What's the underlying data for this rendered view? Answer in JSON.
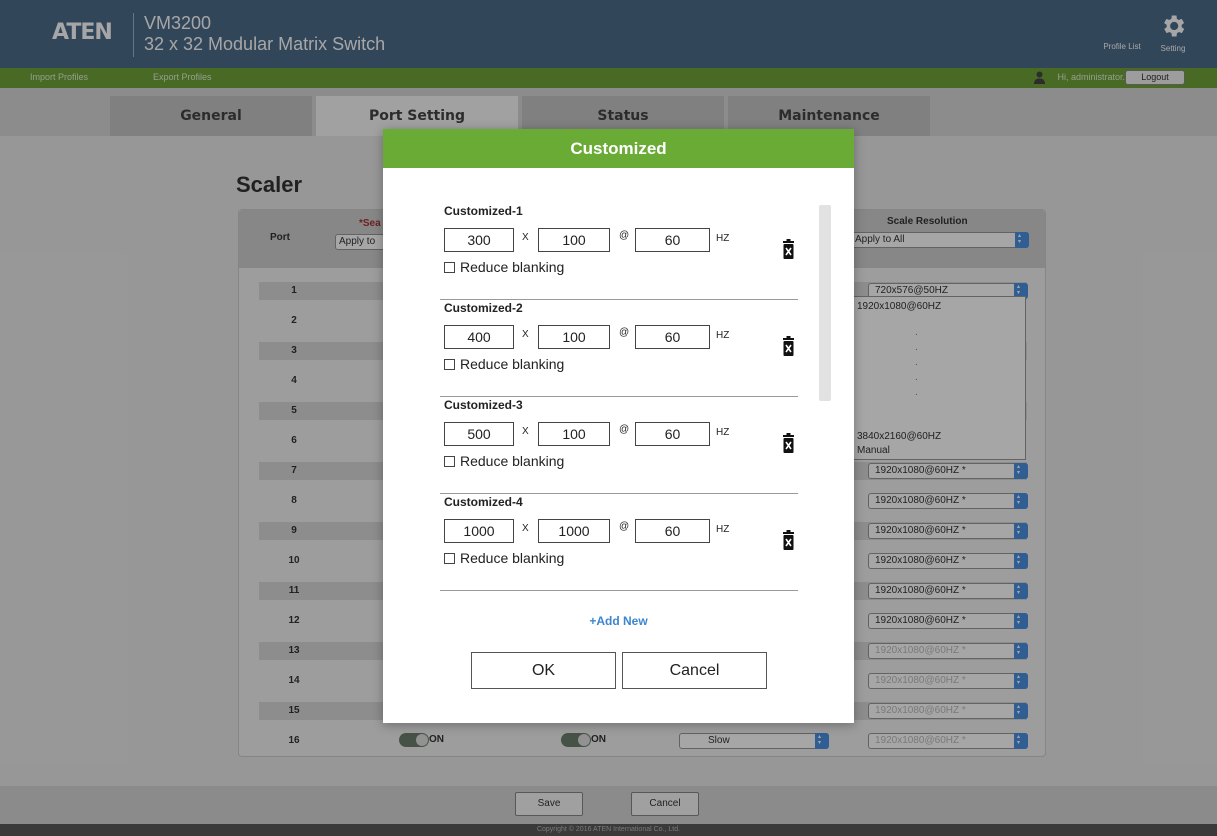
{
  "header": {
    "logo": "ATEN",
    "model": "VM3200",
    "product_name": "32 x 32 Modular Matrix Switch",
    "profile_list": "Profile List",
    "setting": "Setting"
  },
  "subbar": {
    "import_profiles": "Import Profiles",
    "export_profiles": "Export Profiles",
    "greeting": "Hi, administrator.",
    "logout": "Logout"
  },
  "tabs": [
    {
      "label": "General"
    },
    {
      "label": "Port Setting"
    },
    {
      "label": "Status"
    },
    {
      "label": "Maintenance"
    }
  ],
  "main": {
    "title": "Scaler",
    "col_port": "Port",
    "col_seamless": "*Sea",
    "col_seamless_apply": "Apply to",
    "col_scale_res": "Scale Resolution",
    "col_scale_apply": "Apply to All",
    "rows": [
      {
        "port": "1",
        "res": "720x576@50HZ"
      },
      {
        "port": "2",
        "res": ""
      },
      {
        "port": "3",
        "res": ""
      },
      {
        "port": "4",
        "res": ""
      },
      {
        "port": "5",
        "res": ""
      },
      {
        "port": "6",
        "res": ""
      },
      {
        "port": "7",
        "res": "1920x1080@60HZ *"
      },
      {
        "port": "8",
        "res": "1920x1080@60HZ *"
      },
      {
        "port": "9",
        "res": "1920x1080@60HZ *"
      },
      {
        "port": "10",
        "res": "1920x1080@60HZ *"
      },
      {
        "port": "11",
        "res": "1920x1080@60HZ *"
      },
      {
        "port": "12",
        "res": "1920x1080@60HZ *"
      },
      {
        "port": "13",
        "res": "1920x1080@60HZ *"
      },
      {
        "port": "14",
        "res": "1920x1080@60HZ *"
      },
      {
        "port": "15",
        "res": "1920x1080@60HZ *"
      },
      {
        "port": "16",
        "res": "1920x1080@60HZ *"
      }
    ],
    "row16": {
      "toggle1": "ON",
      "toggle2": "ON",
      "speed": "Slow"
    },
    "dropdown_options": {
      "first": "1920x1080@60HZ",
      "dot": ".",
      "last1": "3840x2160@60HZ",
      "last2": "Manual"
    },
    "save": "Save",
    "cancel": "Cancel",
    "copyright": "Copyright © 2016 ATEN International Co., Ltd."
  },
  "modal": {
    "title": "Customized",
    "entries": [
      {
        "name": "Customized-1",
        "width": "300",
        "height": "100",
        "hz": "60"
      },
      {
        "name": "Customized-2",
        "width": "400",
        "height": "100",
        "hz": "60"
      },
      {
        "name": "Customized-3",
        "width": "500",
        "height": "100",
        "hz": "60"
      },
      {
        "name": "Customized-4",
        "width": "1000",
        "height": "1000",
        "hz": "60"
      }
    ],
    "x_sym": "X",
    "at_sym": "@",
    "hz_label": "HZ",
    "reduce_blanking": "Reduce blanking",
    "add_new": "+Add New",
    "ok": "OK",
    "cancel": "Cancel"
  }
}
